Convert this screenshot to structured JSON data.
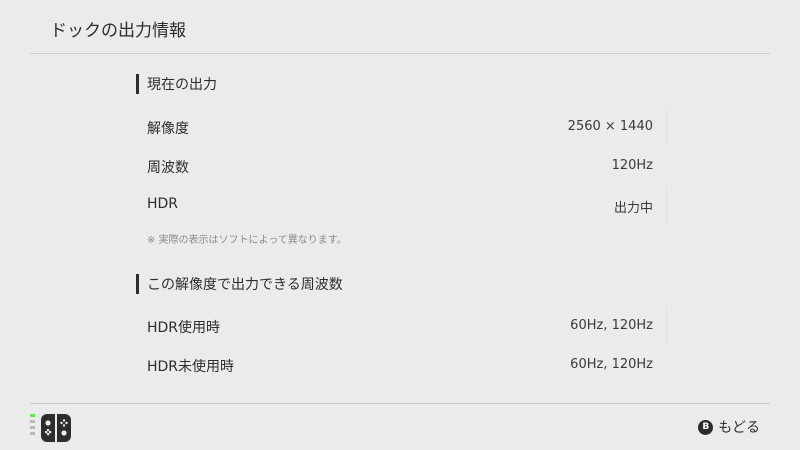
{
  "header": {
    "title": "ドックの出力情報"
  },
  "current_output": {
    "title": "現在の出力",
    "rows": [
      {
        "label": "解像度",
        "value": "2560 × 1440"
      },
      {
        "label": "周波数",
        "value": "120Hz"
      },
      {
        "label": "HDR",
        "value": "出力中"
      }
    ],
    "note": "※ 実際の表示はソフトによって異なります。"
  },
  "supported_frequencies": {
    "title": "この解像度で出力できる周波数",
    "rows": [
      {
        "label": "HDR使用時",
        "value": "60Hz, 120Hz"
      },
      {
        "label": "HDR未使用時",
        "value": "60Hz, 120Hz"
      }
    ]
  },
  "footer": {
    "back_button_glyph": "B",
    "back_label": "もどる",
    "controller_icon": "joy-con-pair-icon",
    "battery_icon": "controller-battery-icon"
  },
  "colors": {
    "background": "#ebebeb",
    "text": "#2d2d2d",
    "divider": "#cdcdcd",
    "battery_on": "#5ee64c"
  }
}
